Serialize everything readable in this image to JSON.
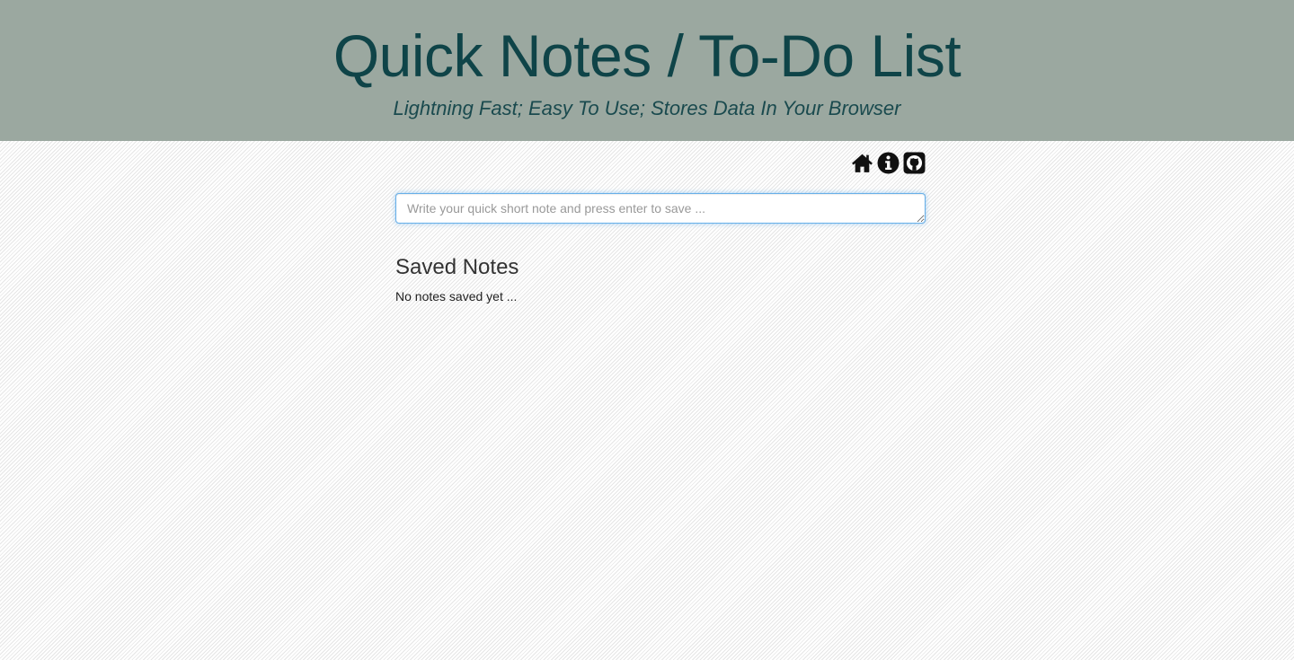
{
  "header": {
    "title": "Quick Notes / To-Do List",
    "subtitle": "Lightning Fast; Easy To Use; Stores Data In Your Browser"
  },
  "toolbar": {
    "icons": [
      "home-icon",
      "info-icon",
      "github-icon"
    ]
  },
  "note_input": {
    "value": "",
    "placeholder": "Write your quick short note and press enter to save ..."
  },
  "saved_notes": {
    "heading": "Saved Notes",
    "empty_message": "No notes saved yet ...",
    "items": []
  },
  "colors": {
    "header_bg": "#9ba8a0",
    "title_color": "#0f4448",
    "input_focus_border": "#66afe9"
  }
}
